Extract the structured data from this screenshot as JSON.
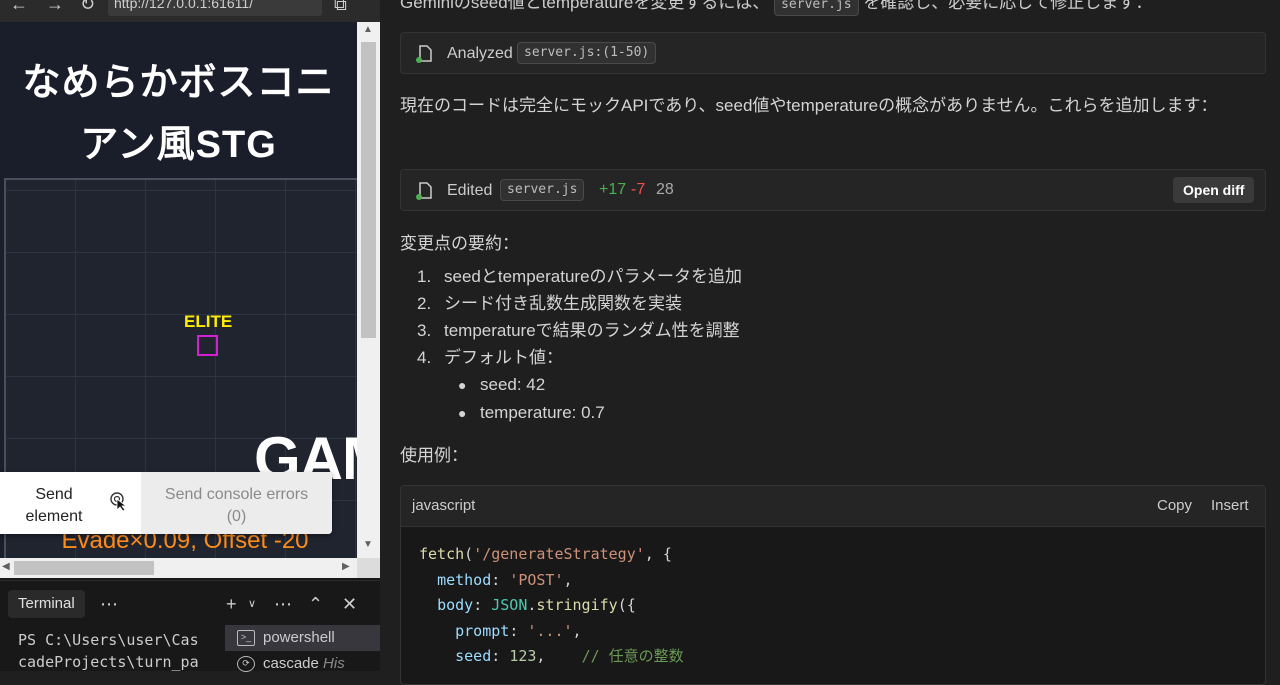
{
  "browser": {
    "url": "http://127.0.0.1:61611/"
  },
  "game": {
    "title_line1": "なめらかボスコニ",
    "title_line2": "アン風STG",
    "enemy_label": "ELITE",
    "game_over_text": "GAM",
    "stats_text": "Evade×0.09, Offset -20"
  },
  "send_popup": {
    "send_element_line1": "Send",
    "send_element_line2": "element",
    "send_console_line1": "Send console errors",
    "send_console_line2": "(0)"
  },
  "terminal": {
    "tab_label": "Terminal",
    "output_line1": "PS C:\\Users\\user\\Cas",
    "output_line2": "cadeProjects\\turn_pa",
    "sessions": [
      {
        "label": "powershell"
      },
      {
        "label": "cascade",
        "suffix": "His"
      }
    ]
  },
  "chat": {
    "top_line_before": "Geminiのseed値とtemperatureを変更するには、",
    "top_line_code": "server.js",
    "top_line_after": "を確認し、必要に応じて修正します：",
    "card1": {
      "verb": "Analyzed",
      "file": "server.js:(1-50)"
    },
    "paragraph1": "現在のコードは完全にモックAPIであり、seed値やtemperatureの概念がありません。これらを追加します：",
    "card2": {
      "verb": "Edited",
      "file": "server.js",
      "additions": "+17",
      "deletions": "-7",
      "total": "28",
      "open_diff_label": "Open diff"
    },
    "summary_title": "変更点の要約：",
    "summary_items": [
      {
        "num": "1.",
        "text": "seedとtemperatureのパラメータを追加"
      },
      {
        "num": "2.",
        "text": "シード付き乱数生成関数を実装"
      },
      {
        "num": "3.",
        "text": "temperatureで結果のランダム性を調整"
      },
      {
        "num": "4.",
        "text": "デフォルト値："
      }
    ],
    "default_values": [
      {
        "text": "seed: 42"
      },
      {
        "text": "temperature: 0.7"
      }
    ],
    "usage_title": "使用例：",
    "code_block": {
      "language": "javascript",
      "copy_label": "Copy",
      "insert_label": "Insert",
      "fn_name": "fetch",
      "endpoint": "'/generateStrategy'",
      "method_key": "method",
      "method_value": "'POST'",
      "body_key": "body",
      "json_obj": "JSON",
      "stringify": "stringify",
      "prompt_key": "prompt",
      "prompt_value": "'...'",
      "seed_key": "seed",
      "seed_value": "123",
      "seed_comment": "// 任意の整数"
    }
  },
  "colors": {
    "accent_add": "#4caf50",
    "accent_delete": "#f14c4c",
    "game_title": "#ffffff",
    "enemy_label": "#ffee00",
    "enemy_box": "#d21fd2",
    "stats": "#ff8c1a"
  },
  "icons": {
    "back": "arrow-left-icon",
    "forward": "arrow-right-icon",
    "reload": "reload-icon",
    "open_external": "open-external-icon",
    "pointer": "pointer-icon",
    "file": "file-icon",
    "terminal": "terminal-icon"
  }
}
